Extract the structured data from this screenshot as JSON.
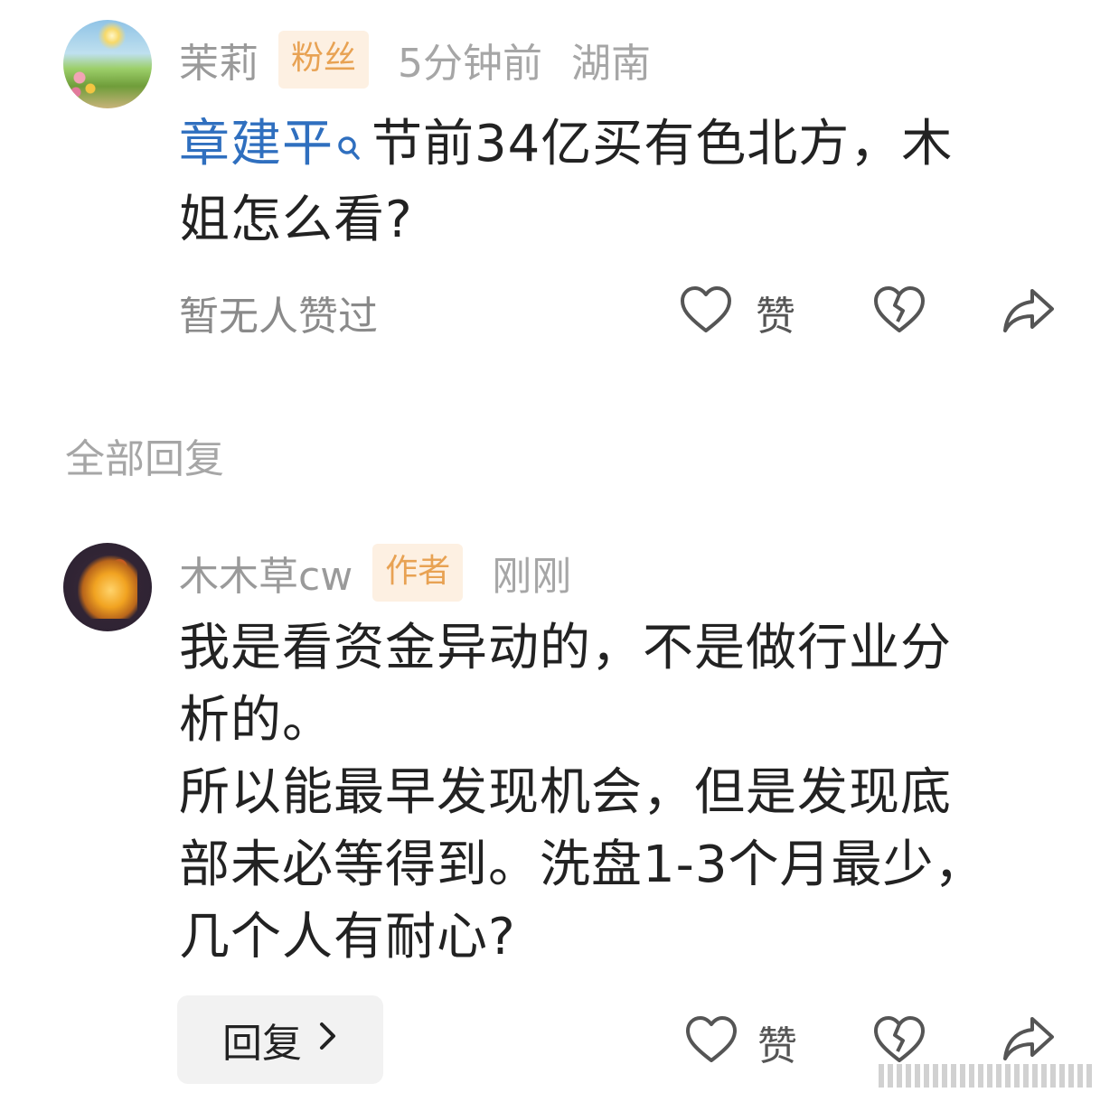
{
  "comment": {
    "user": "茉莉",
    "badge": "粉丝",
    "time": "5分钟前",
    "location": "湖南",
    "mention": "章建平",
    "text_rest_line1": "节前34亿买有色北方，木",
    "text_line2": "姐怎么看?",
    "likes_summary": "暂无人赞过",
    "like_label": "赞"
  },
  "replies_header": "全部回复",
  "reply": {
    "user": "木木草cw",
    "badge": "作者",
    "time": "刚刚",
    "lines": [
      "我是看资金异动的，不是做行业分",
      "析的。",
      "所以能最早发现机会，但是发现底",
      "部未必等得到。洗盘1-3个月最少，",
      "几个人有耐心?"
    ],
    "reply_button": "回复",
    "like_label": "赞"
  },
  "colors": {
    "mention": "#2f6fbf",
    "badge_text": "#e8a253",
    "badge_bg": "#fdf0e2",
    "secondary_text": "#9a9a9a"
  },
  "icons": [
    "heart-icon",
    "broken-heart-icon",
    "share-icon",
    "search-icon",
    "chevron-right-icon"
  ]
}
